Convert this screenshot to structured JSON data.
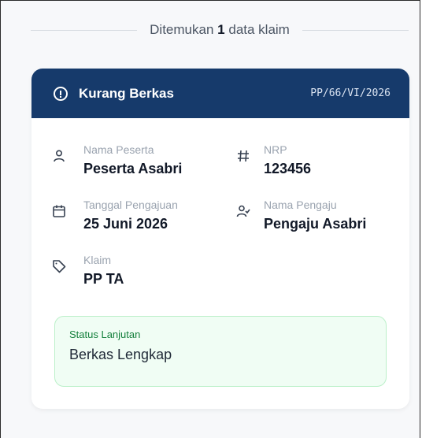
{
  "summary": {
    "prefix": "Ditemukan",
    "count": "1",
    "suffix": "data klaim"
  },
  "card": {
    "status": "Kurang Berkas",
    "claim_number": "PP/66/VI/2026",
    "header_color": "#163a6b",
    "fields": {
      "nama_peserta": {
        "label": "Nama Peserta",
        "value": "Peserta Asabri",
        "icon": "user-icon"
      },
      "nrp": {
        "label": "NRP",
        "value": "123456",
        "icon": "hash-icon"
      },
      "tanggal_pengajuan": {
        "label": "Tanggal Pengajuan",
        "value": "25 Juni 2026",
        "icon": "calendar-icon"
      },
      "nama_pengaju": {
        "label": "Nama Pengaju",
        "value": "Pengaju Asabri",
        "icon": "user-check-icon"
      },
      "klaim": {
        "label": "Klaim",
        "value": "PP TA",
        "icon": "tag-icon"
      }
    },
    "status_lanjutan": {
      "label": "Status Lanjutan",
      "value": "Berkas Lengkap"
    }
  }
}
